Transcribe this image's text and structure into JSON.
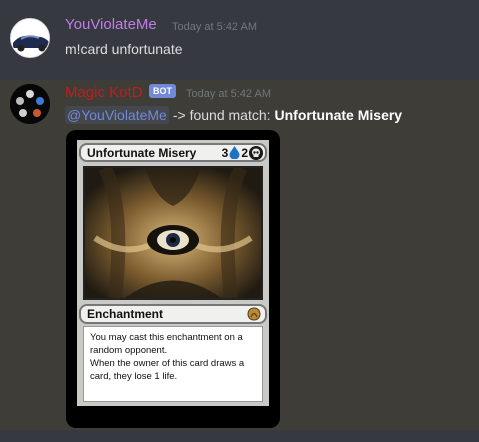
{
  "messages": [
    {
      "username": "YouViolateMe",
      "timestamp": "Today at 5:42 AM",
      "text": "m!card unfortunate"
    },
    {
      "username": "Magic KotD",
      "badge": "BOT",
      "timestamp": "Today at 5:42 AM",
      "mention": "@YouViolateMe",
      "text_mid": "-> found match:",
      "text_bold": "Unfortunate Misery"
    }
  ],
  "card": {
    "name": "Unfortunate Misery",
    "cost_generic_1": "3",
    "cost_generic_2": "2",
    "type_line": "Enchantment",
    "rules_text": "You may cast this enchantment on a random opponent.\nWhen the owner of this card draws a card, they lose 1 life.",
    "mana_icons": [
      "blue-mana-drop-icon",
      "black-mana-skull-icon"
    ]
  },
  "colors": {
    "user1_name": "#c27ce8",
    "bot_name": "#c21d1d",
    "bot_badge": "#7289da",
    "mention": "#7289da"
  }
}
